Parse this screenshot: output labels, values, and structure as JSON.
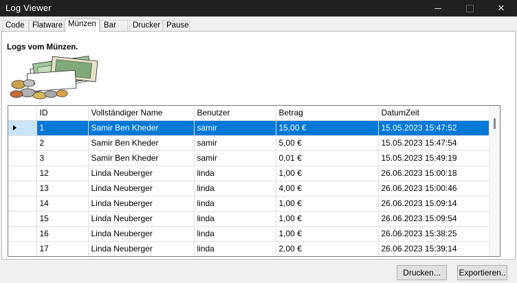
{
  "window": {
    "title": "Log Viewer"
  },
  "tabs": [
    "Code",
    "Flatware",
    "Münzen",
    "Bar",
    "Drucker",
    "Pause"
  ],
  "active_tab": "Münzen",
  "heading": "Logs vom Münzen.",
  "grid": {
    "columns": [
      "ID",
      "Vollständiger Name",
      "Benutzer",
      "Betrag",
      "DatumZeit"
    ],
    "rows": [
      [
        "1",
        "Samir Ben Kheder",
        "samir",
        "15,00 €",
        "15.05.2023 15:47:52"
      ],
      [
        "2",
        "Samir Ben Kheder",
        "samir",
        "5,00 €",
        "15.05.2023 15:47:54"
      ],
      [
        "3",
        "Samir Ben Kheder",
        "samir",
        "0,01 €",
        "15.05.2023 15:49:19"
      ],
      [
        "12",
        "Linda Neuberger",
        "linda",
        "1,00 €",
        "26.06.2023 15:00:18"
      ],
      [
        "13",
        "Linda Neuberger",
        "linda",
        "4,00 €",
        "26.06.2023 15:00:46"
      ],
      [
        "14",
        "Linda Neuberger",
        "linda",
        "1,00 €",
        "26.06.2023 15:09:14"
      ],
      [
        "15",
        "Linda Neuberger",
        "linda",
        "1,00 €",
        "26.06.2023 15:09:54"
      ],
      [
        "16",
        "Linda Neuberger",
        "linda",
        "1,00 €",
        "26.06.2023 15:38:25"
      ],
      [
        "17",
        "Linda Neuberger",
        "linda",
        "2,00 €",
        "26.06.2023 15:39:14"
      ]
    ],
    "selected_row": 0
  },
  "buttons": {
    "print": "Drucken...",
    "export": "Exportieren.."
  },
  "colors": {
    "selection": "#0078d7",
    "titlebar": "#202020"
  }
}
